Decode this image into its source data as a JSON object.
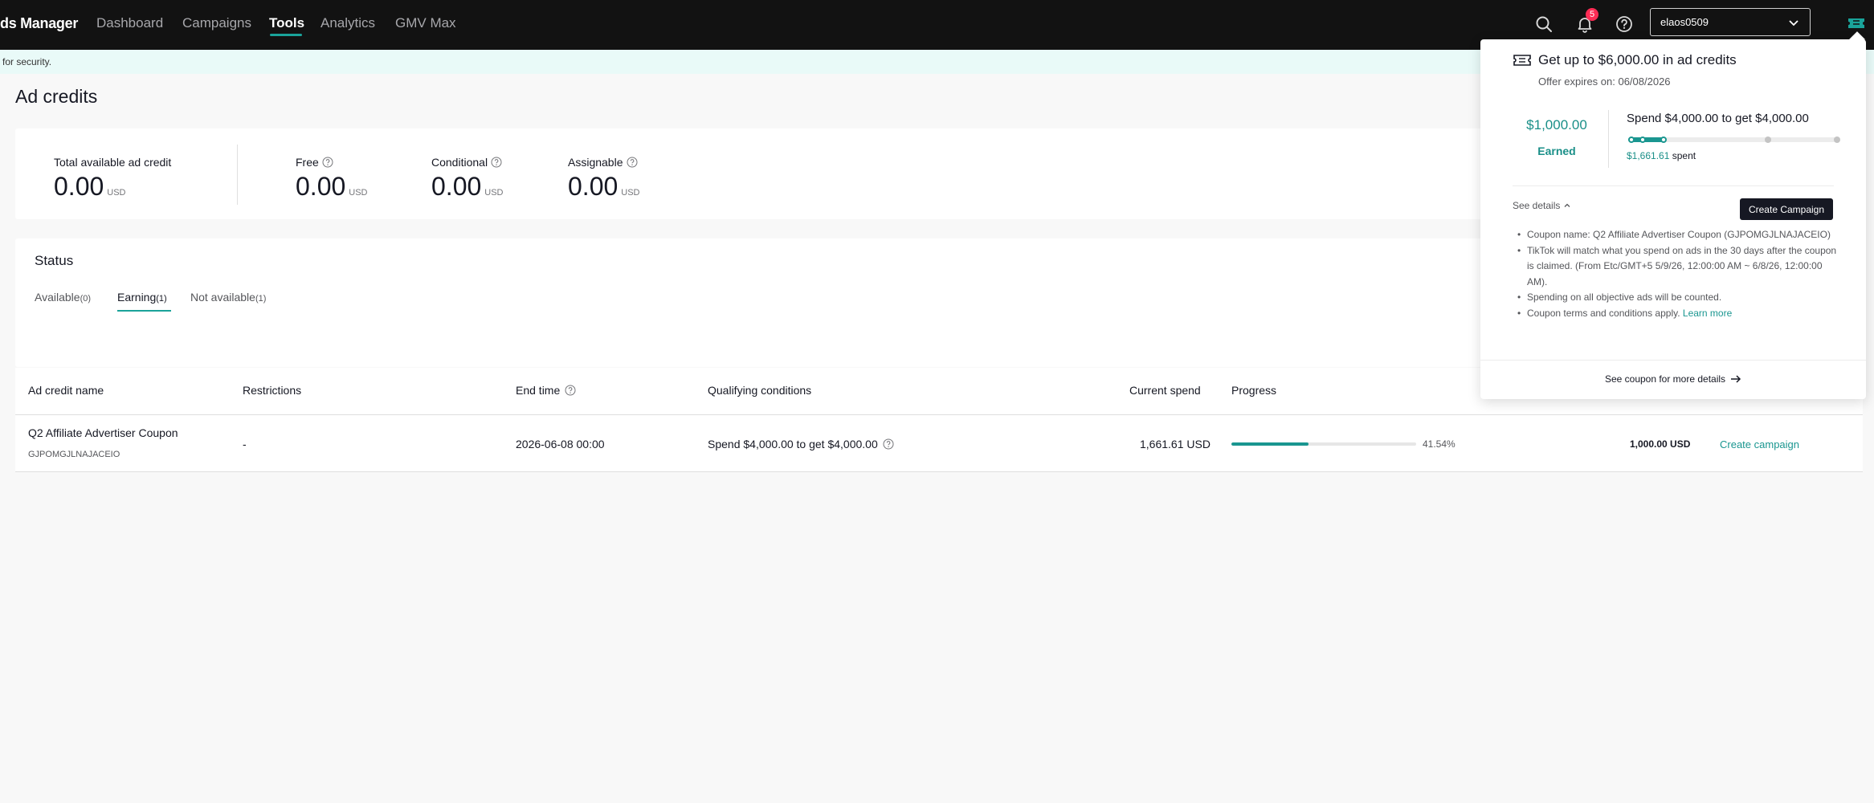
{
  "nav": {
    "brand": "ds Manager",
    "items": [
      "Dashboard",
      "Campaigns",
      "Tools",
      "Analytics",
      "GMV Max"
    ],
    "active": "Tools",
    "notification_count": "5",
    "account_name": "elaos0509"
  },
  "notice": "for security.",
  "page_title": "Ad credits",
  "summary": {
    "total_label": "Total available ad credit",
    "total_value": "0.00",
    "free_label": "Free",
    "free_value": "0.00",
    "conditional_label": "Conditional",
    "conditional_value": "0.00",
    "assignable_label": "Assignable",
    "assignable_value": "0.00",
    "unit": "USD"
  },
  "status": {
    "title": "Status",
    "tabs": [
      {
        "label": "Available",
        "count": "(0)"
      },
      {
        "label": "Earning",
        "count": "(1)"
      },
      {
        "label": "Not available",
        "count": "(1)"
      }
    ]
  },
  "table": {
    "headers": {
      "name": "Ad credit name",
      "restrictions": "Restrictions",
      "end_time": "End time",
      "conditions": "Qualifying conditions",
      "current_spend": "Current spend",
      "progress": "Progress"
    },
    "row": {
      "name": "Q2 Affiliate Advertiser Coupon",
      "code": "GJPOMGJLNAJACEIO",
      "restrictions": "-",
      "end_time": "2026-06-08 00:00",
      "conditions": "Spend $4,000.00 to get $4,000.00",
      "current_spend": "1,661.61 USD",
      "progress_pct": 41.54,
      "progress_text": "41.54%",
      "amount": "1,000.00 USD",
      "action": "Create campaign"
    }
  },
  "popover": {
    "title": "Get up to $6,000.00 in ad credits",
    "expires": "Offer expires on: 06/08/2026",
    "earned_amount": "$1,000.00",
    "earned_label": "Earned",
    "spend_title": "Spend $4,000.00 to get $4,000.00",
    "spent_amount": "$1,661.61",
    "spent_suffix": " spent",
    "spend_progress": 0.18,
    "see_details": "See details",
    "create_button": "Create Campaign",
    "bullets": [
      "Coupon name: Q2 Affiliate Advertiser Coupon (GJPOMGJLNAJACEIO)",
      "TikTok will match what you spend on ads in the 30 days after the coupon is claimed. (From Etc/GMT+5 5/9/26, 12:00:00 AM ~ 6/8/26, 12:00:00 AM).",
      "Spending on all objective ads will be counted.",
      "Coupon terms and conditions apply."
    ],
    "learn_more": "Learn more",
    "footer": "See coupon for more details"
  },
  "colors": {
    "accent": "#1a9690",
    "topbar": "#121212",
    "badge": "#fe2c55"
  }
}
